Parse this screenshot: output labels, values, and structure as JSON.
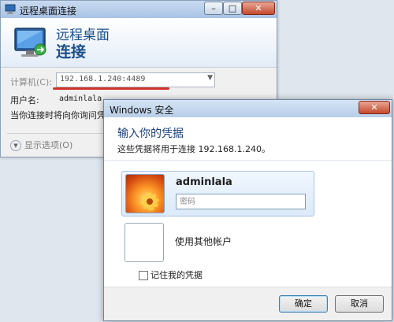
{
  "rdp_window": {
    "title": "远程桌面连接",
    "heading_line1": "远程桌面",
    "heading_line2": "连接",
    "computer_label": "计算机(C):",
    "computer_value": "192.168.1.240:4489",
    "username_label": "用户名:",
    "username_value": "adminlala",
    "note": "当你连接时将向你询问凭据。",
    "show_options": "显示选项(O)",
    "window_controls": {
      "minimize": "–",
      "maximize": "□",
      "close": "✕"
    },
    "icon": "monitor-icon"
  },
  "security_dialog": {
    "title": "Windows 安全",
    "heading": "输入你的凭据",
    "subtitle": "这些凭据将用于连接 192.168.1.240。",
    "user_tile": {
      "username": "adminlala",
      "password_placeholder": "密码"
    },
    "other_account_label": "使用其他帐户",
    "remember_label": "记住我的凭据",
    "ok_label": "确定",
    "cancel_label": "取消",
    "close": "✕"
  }
}
